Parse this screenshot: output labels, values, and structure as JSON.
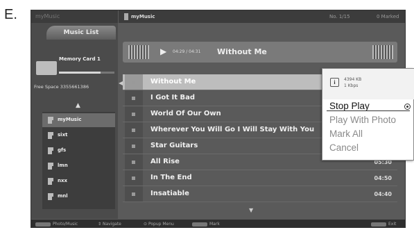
{
  "figure_label": "E.",
  "sidebar": {
    "app_title": "myMusic",
    "tab_label": "Music List",
    "device_name": "Memory Card 1",
    "free_space": "Free Space 3355661386",
    "folders": [
      {
        "label": "myMusic",
        "selected": true
      },
      {
        "label": "sixt"
      },
      {
        "label": "gfs"
      },
      {
        "label": "lmn"
      },
      {
        "label": "nxx"
      },
      {
        "label": "mnl"
      }
    ]
  },
  "header": {
    "path": "myMusic",
    "count": "No. 1/15",
    "marked": "0 Marked"
  },
  "now_playing": {
    "play_symbol": "▶",
    "time": "04:29 / 04:31",
    "title": "Without Me"
  },
  "tracks": [
    {
      "title": "Without Me",
      "duration": "",
      "selected": true
    },
    {
      "title": "I Got It Bad",
      "duration": ""
    },
    {
      "title": "World Of Our Own",
      "duration": ""
    },
    {
      "title": "Wherever You Will Go I Will Stay With You",
      "duration": ""
    },
    {
      "title": "Star Guitars",
      "duration": ""
    },
    {
      "title": "All Rise",
      "duration": "05:30"
    },
    {
      "title": "In The End",
      "duration": "04:50"
    },
    {
      "title": "Insatiable",
      "duration": "04:40"
    }
  ],
  "popup": {
    "info_glyph": "i",
    "file_size": "4394 KB",
    "bit_rate": "1 Kbps",
    "options": [
      {
        "label": "Stop Play",
        "active": true
      },
      {
        "label": "Play With Photo"
      },
      {
        "label": "Mark All"
      },
      {
        "label": "Cancel"
      }
    ]
  },
  "bottom_bar": {
    "photo_music": "Photo/Music",
    "navigate": "Navigate",
    "popup_menu": "Popup Menu",
    "mark": "Mark",
    "exit": "Exit"
  },
  "icons": {
    "navigate_symbol": "⇕",
    "popup_symbol": "⊙",
    "up_arrow": "▲",
    "down_arrow": "▼",
    "left_arrow": "◀"
  },
  "colors": {
    "screen_bg": "#5a5a5a",
    "selected_row": "#bdbdbd",
    "popup_bg": "#ffffff"
  }
}
